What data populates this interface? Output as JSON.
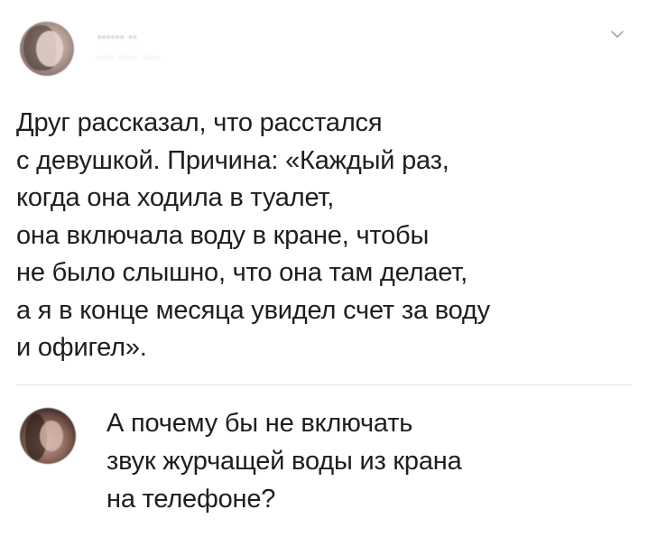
{
  "tweet": {
    "author_name": "······ ··",
    "author_handle": "···· ····· ····",
    "menu_icon": "chevron-down-icon",
    "lines": [
      "Друг рассказал, что расстался",
      "с девушкой. Причина: «Каждый раз,",
      "когда она ходила в туалет,",
      "она включала воду в кране, чтобы",
      "не было слышно, что она там делает,",
      "а я в конце месяца увидел счет за воду",
      "и офигел»."
    ]
  },
  "reply": {
    "lines": [
      "А почему бы не включать",
      "звук журчащей воды из крана",
      "на телефоне?"
    ]
  },
  "colors": {
    "text": "#1e1e1e",
    "divider": "#e3e6ea",
    "chevron": "#8899a6"
  }
}
